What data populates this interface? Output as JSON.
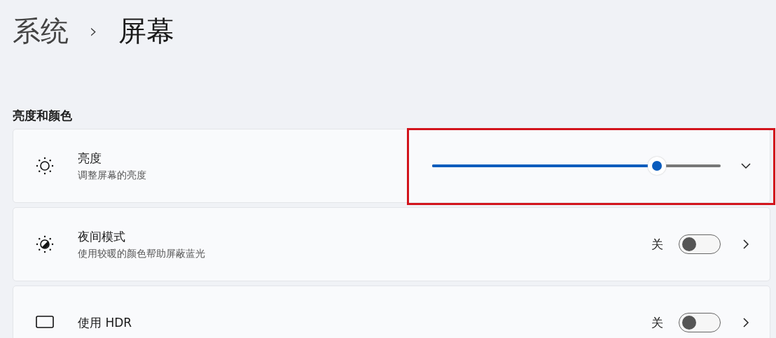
{
  "breadcrumb": {
    "parent": "系统",
    "separator": "›",
    "current": "屏幕"
  },
  "section": {
    "heading": "亮度和颜色",
    "settings": [
      {
        "kind": "slider",
        "title": "亮度",
        "subtitle": "调整屏幕的亮度",
        "level": 0.78,
        "highlighted": true
      },
      {
        "kind": "toggle",
        "title": "夜间模式",
        "subtitle": "使用较暖的颜色帮助屏蔽蓝光",
        "state_label": "关",
        "on": false,
        "highlighted": false
      },
      {
        "kind": "toggle",
        "title": "使用 HDR",
        "state_label": "关",
        "on": false,
        "highlighted": false
      }
    ]
  }
}
